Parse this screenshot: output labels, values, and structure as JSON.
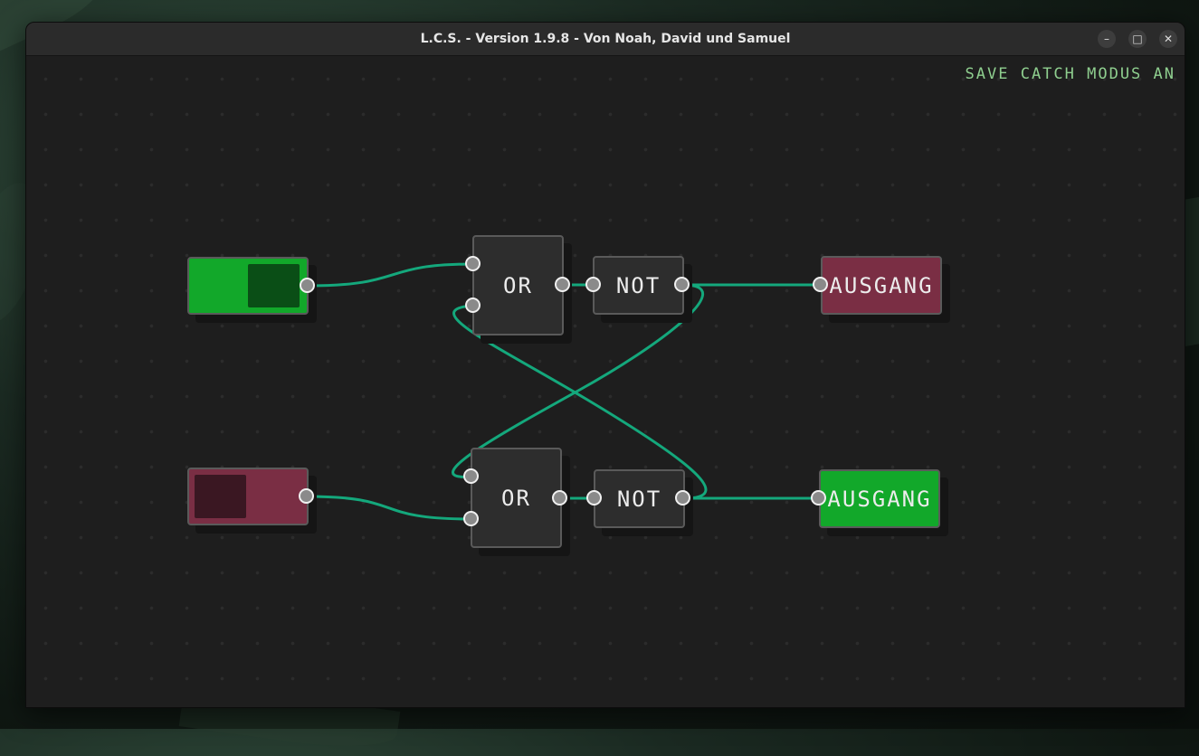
{
  "window": {
    "title": "L.C.S. - Version 1.9.8 - Von Noah, David und Samuel"
  },
  "status_text": "SAVE CATCH MODUS AN",
  "colors": {
    "on": "#12a82a",
    "off": "#7a2e44",
    "knob_on": "#0a4e16",
    "knob_off": "#3a1722",
    "wire": "#14a87c",
    "gate_bg": "#2d2d2d"
  },
  "switches": [
    {
      "state": "on"
    },
    {
      "state": "off"
    }
  ],
  "gates": [
    {
      "label": "OR"
    },
    {
      "label": "NOT"
    },
    {
      "label": "OR"
    },
    {
      "label": "NOT"
    }
  ],
  "outputs": [
    {
      "label": "AUSGANG",
      "state": "off"
    },
    {
      "label": "AUSGANG",
      "state": "on"
    }
  ],
  "window_controls": {
    "minimize": "–",
    "maximize": "□",
    "close": "✕"
  }
}
